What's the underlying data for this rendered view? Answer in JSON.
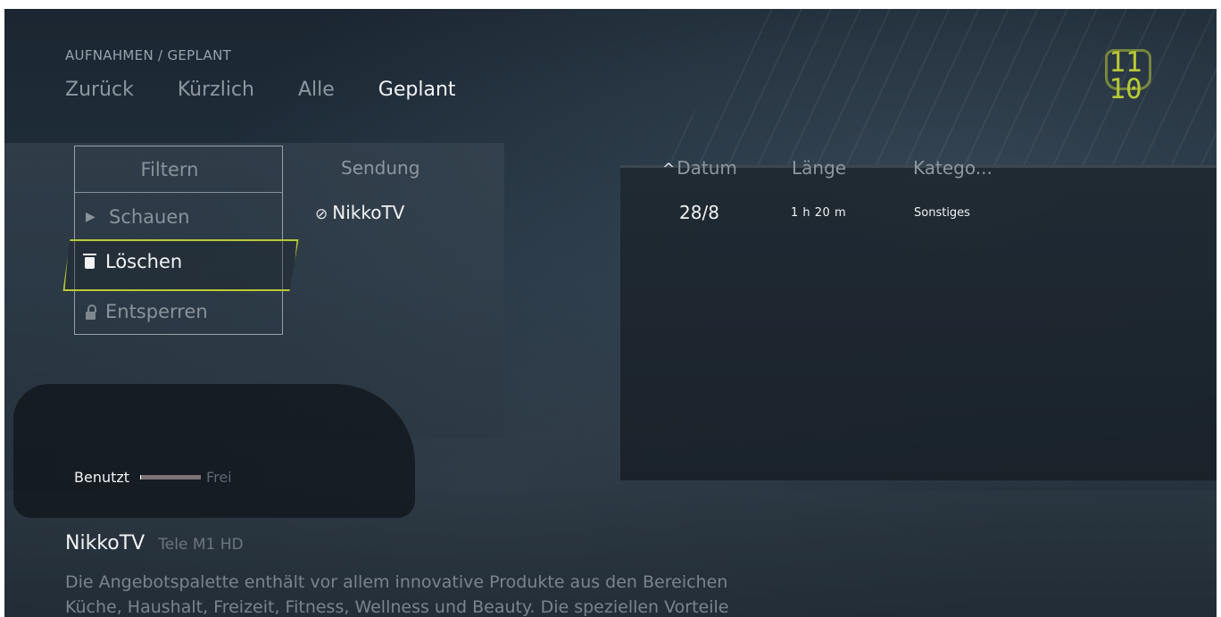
{
  "breadcrumb": "AUFNAHMEN / GEPLANT",
  "nav": {
    "tabs": [
      {
        "label": "Zurück",
        "active": false
      },
      {
        "label": "Kürzlich",
        "active": false
      },
      {
        "label": "Alle",
        "active": false
      },
      {
        "label": "Geplant",
        "active": true
      }
    ]
  },
  "clock": {
    "hours": "11",
    "minutes": "10"
  },
  "menu": {
    "filter_label": "Filtern",
    "watch_label": "Schauen",
    "delete_label": "Löschen",
    "unlock_label": "Entsperren",
    "selected": "delete"
  },
  "table": {
    "columns": {
      "title": "Sendung",
      "date": "Datum",
      "length": "Länge",
      "category": "Katego..."
    },
    "sort": {
      "column": "date",
      "direction": "ascending"
    },
    "rows": [
      {
        "title": "NikkoTV",
        "date": "28/8",
        "length": "1 h 20 m",
        "category": "Sonstiges"
      }
    ]
  },
  "storage": {
    "used_label": "Benutzt",
    "free_label": "Frei",
    "used_fraction": 0.02
  },
  "detail": {
    "title": "NikkoTV",
    "channel": "Tele M1 HD",
    "description_lines": [
      "Die Angebotspalette enthält vor allem innovative Produkte aus den Bereichen",
      "Küche, Haushalt, Freizeit, Fitness, Wellness und Beauty. Die speziellen Vorteile"
    ]
  },
  "colors": {
    "accent": "#b8c936",
    "text_primary": "#f1f3f4",
    "text_muted": "#8e979f"
  }
}
